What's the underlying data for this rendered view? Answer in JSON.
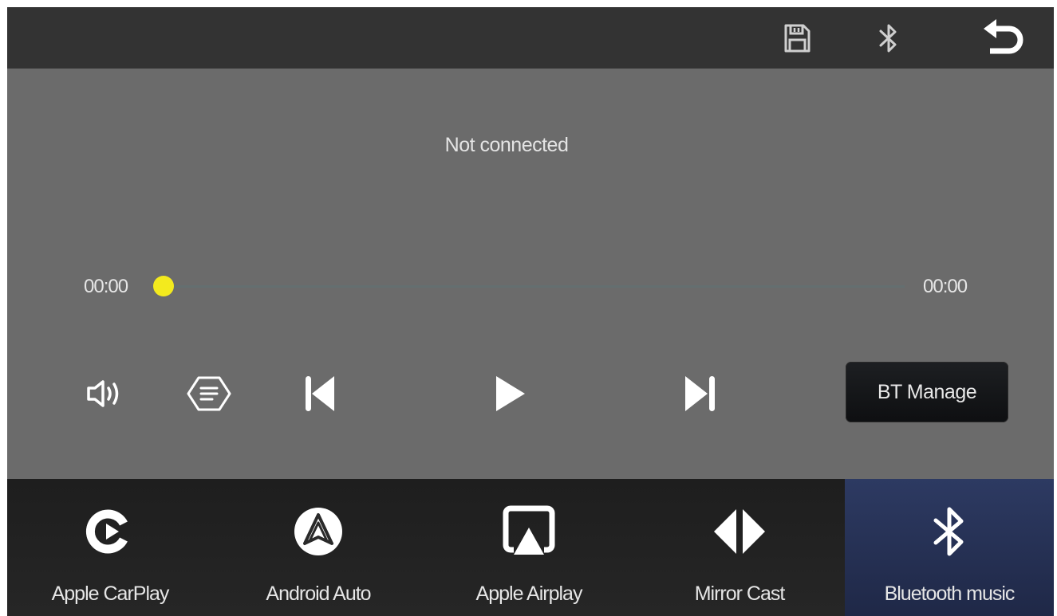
{
  "topbar": {
    "icons": [
      "save-icon",
      "bluetooth-icon",
      "back-arrow-icon"
    ]
  },
  "player": {
    "status": "Not connected",
    "time_elapsed": "00:00",
    "time_total": "00:00",
    "progress": 0,
    "controls": [
      "volume-icon",
      "list-icon",
      "previous-track-icon",
      "play-icon",
      "next-track-icon"
    ],
    "bt_manage_label": "BT Manage"
  },
  "colors": {
    "accent_knob": "#f3ea1e",
    "active_tab": "#2d3a62"
  },
  "nav": {
    "items": [
      {
        "label": "Apple CarPlay",
        "icon": "carplay-icon",
        "active": false
      },
      {
        "label": "Android Auto",
        "icon": "android-auto-icon",
        "active": false
      },
      {
        "label": "Apple Airplay",
        "icon": "airplay-icon",
        "active": false
      },
      {
        "label": "Mirror Cast",
        "icon": "mirror-cast-icon",
        "active": false
      },
      {
        "label": "Bluetooth music",
        "icon": "bluetooth-icon",
        "active": true
      }
    ]
  }
}
